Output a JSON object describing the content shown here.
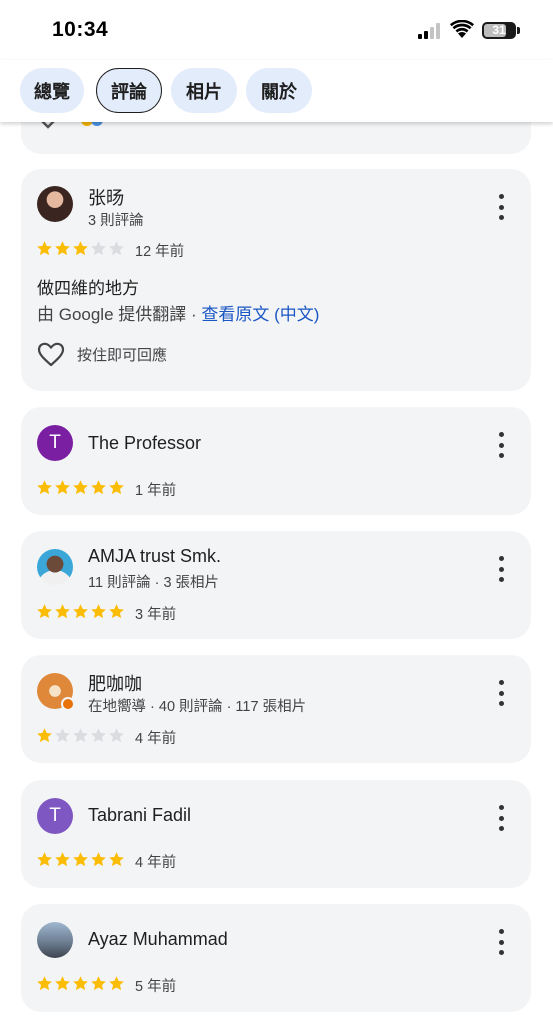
{
  "status_bar": {
    "time": "10:34",
    "battery": "31"
  },
  "tabs": [
    {
      "label": "總覽",
      "active": false
    },
    {
      "label": "評論",
      "active": true
    },
    {
      "label": "相片",
      "active": false
    },
    {
      "label": "關於",
      "active": false
    }
  ],
  "reviews": [
    {
      "name": "张旸",
      "meta": "3 則評論",
      "rating": 3,
      "when": "12 年前",
      "text": "做四維的地方",
      "translation_prefix": "由 Google 提供翻譯 · ",
      "translation_link": "查看原文 (中文)",
      "like_label": "按住即可回應"
    },
    {
      "name": "The Professor",
      "avatar_letter": "T",
      "avatar_color": "#7b1fa2",
      "rating": 5,
      "when": "1 年前"
    },
    {
      "name": "AMJA trust Smk.",
      "meta": "11 則評論 · 3 張相片",
      "rating": 5,
      "when": "3 年前"
    },
    {
      "name": "肥咖咖",
      "meta": "在地嚮導 · 40 則評論 · 117 張相片",
      "rating": 1,
      "when": "4 年前"
    },
    {
      "name": "Tabrani Fadil",
      "avatar_letter": "T",
      "avatar_color": "#7e57c2",
      "rating": 5,
      "when": "4 年前"
    },
    {
      "name": "Ayaz Muhammad",
      "rating": 5,
      "when": "5 年前"
    }
  ],
  "colors": {
    "star_filled": "#fbbc04",
    "star_empty": "#dadce0",
    "link": "#1a56c4",
    "tab_bg": "#e3ecfb",
    "card_bg": "#f3f4f6"
  }
}
